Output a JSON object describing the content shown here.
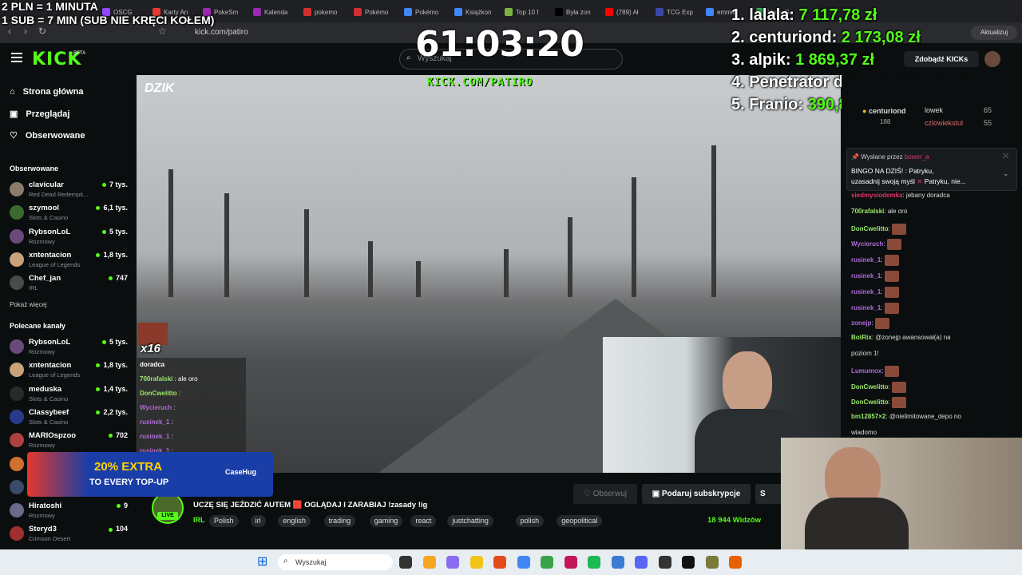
{
  "browser": {
    "tabs": [
      {
        "label": "OSCG",
        "color": "#9146ff"
      },
      {
        "label": "Karty An",
        "color": "#e53935"
      },
      {
        "label": "PokeSm",
        "color": "#9c27b0"
      },
      {
        "label": "Kalenda",
        "color": "#9c27b0"
      },
      {
        "label": "pokemo",
        "color": "#d32f2f"
      },
      {
        "label": "Pokémo",
        "color": "#d32f2f"
      },
      {
        "label": "Pokémo",
        "color": "#4285f4"
      },
      {
        "label": "Książkon",
        "color": "#4285f4"
      },
      {
        "label": "Top 10 f",
        "color": "#7cb342"
      },
      {
        "label": "Była zon",
        "color": "#000000"
      },
      {
        "label": "(789) Ał",
        "color": "#ff0000"
      },
      {
        "label": "TCG Exp",
        "color": "#3949ab"
      },
      {
        "label": "emmik",
        "color": "#4285f4"
      },
      {
        "label": "Mapy G",
        "color": "#34a853"
      }
    ],
    "url": "kick.com/patiro",
    "update_button": "Aktualizuj"
  },
  "overlay": {
    "rate_line1": "2 PLN = 1 MINUTA",
    "rate_line2": "1 SUB = 7 MIN (SUB NIE KRĘCI KOŁEM)",
    "timer": "61:03:20",
    "leaderboard": [
      {
        "rank": "1.",
        "name": "lalala:",
        "amount": "7 117,78 zł"
      },
      {
        "rank": "2.",
        "name": "centuriond:",
        "amount": "2 173,08 zł"
      },
      {
        "rank": "3.",
        "name": "alpik:",
        "amount": "1 869,37 zł"
      },
      {
        "rank": "4.",
        "name": "Penetrator dziurek:",
        "amount": "776,60 zł"
      },
      {
        "rank": "5.",
        "name": "Franio:",
        "amount": "390,83 zł"
      }
    ],
    "stream_url": "KICK.COM/PATIRO",
    "brand": "DZIK",
    "multiplier": "x16"
  },
  "header": {
    "logo": "KICK",
    "beta": "BETA",
    "search_placeholder": "Wyszukaj",
    "get_kicks": "Zdobądź KICKs"
  },
  "sidebar": {
    "nav": [
      {
        "label": "Strona główna",
        "icon": "home-icon"
      },
      {
        "label": "Przeglądaj",
        "icon": "browse-icon"
      },
      {
        "label": "Obserwowane",
        "icon": "heart-icon"
      }
    ],
    "followed_title": "Obserwowane",
    "followed": [
      {
        "name": "clavicular",
        "category": "Red Dead Redempti...",
        "viewers": "7 tys.",
        "color": "#8a7b6a"
      },
      {
        "name": "szymool",
        "category": "Slots & Casino",
        "viewers": "6,1 tys.",
        "color": "#3a6b2e"
      },
      {
        "name": "RybsonLoL",
        "category": "Rozmowy",
        "viewers": "5 tys.",
        "color": "#6a4a7a"
      },
      {
        "name": "xntentacion",
        "category": "League of Legends",
        "viewers": "1,8 tys.",
        "color": "#c9a27a"
      },
      {
        "name": "Chef_jan",
        "category": "IRL",
        "viewers": "747",
        "color": "#4a4a4a"
      }
    ],
    "show_more": "Pokaż więcej",
    "recommended_title": "Polecane kanały",
    "recommended": [
      {
        "name": "RybsonLoL",
        "category": "Rozmowy",
        "viewers": "5 tys.",
        "color": "#6a4a7a"
      },
      {
        "name": "xntentacion",
        "category": "League of Legends",
        "viewers": "1,8 tys.",
        "color": "#c9a27a"
      },
      {
        "name": "meduska",
        "category": "Slots & Casino",
        "viewers": "1,4 tys.",
        "color": "#2a2a2a"
      },
      {
        "name": "Classybeef",
        "category": "Slots & Casino",
        "viewers": "2,2 tys.",
        "color": "#2a3a8a"
      },
      {
        "name": "MARIOspzoo",
        "category": "Rozmowy",
        "viewers": "702",
        "color": "#b04040"
      },
      {
        "name": "",
        "category": "",
        "viewers": "",
        "color": "#d07030"
      },
      {
        "name": "",
        "category": "",
        "viewers": "",
        "color": "#3a4a6a"
      },
      {
        "name": "Hiratoshi",
        "category": "Rozmowy",
        "viewers": "9",
        "color": "#6a6a8a"
      },
      {
        "name": "Steryd3",
        "category": "Crimson Desert",
        "viewers": "104",
        "color": "#a03030"
      }
    ]
  },
  "ad": {
    "headline": "20% EXTRA",
    "subline": "TO EVERY TOP-UP",
    "brand": "CaseHug"
  },
  "minichat": [
    {
      "user": "doradca",
      "text": "",
      "color": "#ffffff"
    },
    {
      "user": "700rafalski",
      "text": ": ale oro",
      "color": "#9be86b"
    },
    {
      "user": "DonCwelitto",
      "text": ":",
      "color": "#9be86b"
    },
    {
      "user": "Wycieruch",
      "text": ":",
      "color": "#b06bd6"
    },
    {
      "user": "rusinek_1",
      "text": ":",
      "color": "#b06bd6"
    },
    {
      "user": "rusinek_1",
      "text": ":",
      "color": "#b06bd6"
    },
    {
      "user": "rusinek_1",
      "text": ":",
      "color": "#b06bd6"
    }
  ],
  "stream": {
    "live_badge": "LIVE",
    "title": "UCZĘ SIĘ JEŹDZIĆ AUTEM 🟥 OGLĄDAJ I ZARABIAJ !zasady !ig",
    "category": "IRL",
    "tags": [
      "Polish",
      "irl",
      "english",
      "trading",
      "gaming",
      "react",
      "justchatting",
      "polish",
      "geopolitical"
    ],
    "viewers": "18 944 Widzów",
    "follow_button": "Obserwuj",
    "sub_button": "Podaruj subskrypcje",
    "extra_button": "S"
  },
  "chat": {
    "top_gifters": [
      {
        "name": "centuriond",
        "value": "188"
      },
      {
        "name": "lowek",
        "value": "65"
      },
      {
        "name": "czlowiekstul",
        "value": "55"
      }
    ],
    "pinned_by_label": "Wysłane przez",
    "pinned_by_user": "bower_a",
    "pinned_text_line1": "BINGO NA DZIŚ!",
    "pinned_text_line1b": ": Patryku,",
    "pinned_text_line2": "uzasadnij swoją myśl",
    "pinned_text_line2b": "Patryku, nie...",
    "messages": [
      {
        "user": "siedmysiodemka",
        "text": ": jebany doradca",
        "color": "#e0356b"
      },
      {
        "user": "700rafalski",
        "text": ": ale oro",
        "color": "#9be86b"
      },
      {
        "user": "DonCwelitto",
        "text": ":",
        "color": "#9be86b"
      },
      {
        "user": "Wycieruch",
        "text": ":",
        "color": "#b06bd6"
      },
      {
        "user": "rusinek_1",
        "text": ":",
        "color": "#b06bd6"
      },
      {
        "user": "rusinek_1",
        "text": ":",
        "color": "#b06bd6"
      },
      {
        "user": "rusinek_1",
        "text": ":",
        "color": "#b06bd6"
      },
      {
        "user": "rusinek_1",
        "text": ":",
        "color": "#b06bd6"
      },
      {
        "user": "zonejp",
        "text": ":",
        "color": "#b06bd6"
      },
      {
        "user": "BotRix",
        "text": ": @zonejp awansował(a) na",
        "color": "#9be86b"
      },
      {
        "user": "",
        "text": "poziom 1!",
        "color": "#ffffff"
      },
      {
        "user": "Lumumox",
        "text": ":",
        "color": "#b06bd6"
      },
      {
        "user": "DonCwelitto",
        "text": ":",
        "color": "#9be86b"
      },
      {
        "user": "DonCwelitto",
        "text": ":",
        "color": "#9be86b"
      },
      {
        "user": "bm12857×2",
        "text": ": @nielimitowane_depo no",
        "color": "#9be86b"
      },
      {
        "user": "",
        "text": "wiadomo",
        "color": "#ffffff"
      }
    ]
  },
  "taskbar": {
    "search_placeholder": "Wyszukaj"
  }
}
